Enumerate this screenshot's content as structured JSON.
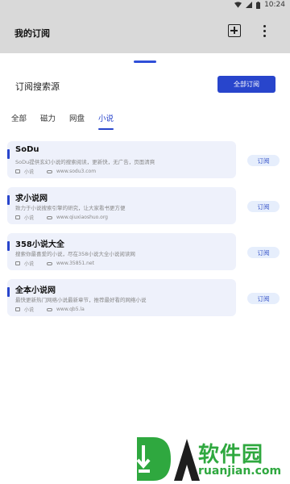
{
  "status_bar": {
    "time": "10:24"
  },
  "app_bar": {
    "title": "我的订阅"
  },
  "section": {
    "title": "订阅搜索源",
    "all_button": "全部订阅"
  },
  "tabs": [
    "全部",
    "磁力",
    "网盘",
    "小说"
  ],
  "active_tab": "小说",
  "colors": {
    "accent": "#2845cc",
    "card_bg": "#eef1fb",
    "watermark_green": "#2fa83f"
  },
  "sources": [
    {
      "title": "SoDu",
      "desc": "SoDu提供玄幻小说的搜索阅读，更新快，无广告，页面清爽",
      "category": "小说",
      "url": "www.sodu3.com",
      "action": "订阅"
    },
    {
      "title": "求小说网",
      "desc": "致力于小说搜索引擎的研究，让大家看书更方便",
      "category": "小说",
      "url": "www.qiuxiaoshuo.org",
      "action": "订阅"
    },
    {
      "title": "358小说大全",
      "desc": "搜索你最喜爱的小说，尽在358小说大全小说阅读网",
      "category": "小说",
      "url": "www.35851.net",
      "action": "订阅"
    },
    {
      "title": "全本小说网",
      "desc": "最快更新热门网络小说最新章节，推荐最好看的网络小说",
      "category": "小说",
      "url": "www.qb5.la",
      "action": "订阅"
    }
  ],
  "watermark": {
    "cn": "软件园",
    "en": "ruanjian.com"
  },
  "icons": [
    "wifi-icon",
    "signal-icon",
    "battery-icon",
    "add-box-icon",
    "more-vert-icon",
    "tag-icon",
    "link-icon"
  ]
}
